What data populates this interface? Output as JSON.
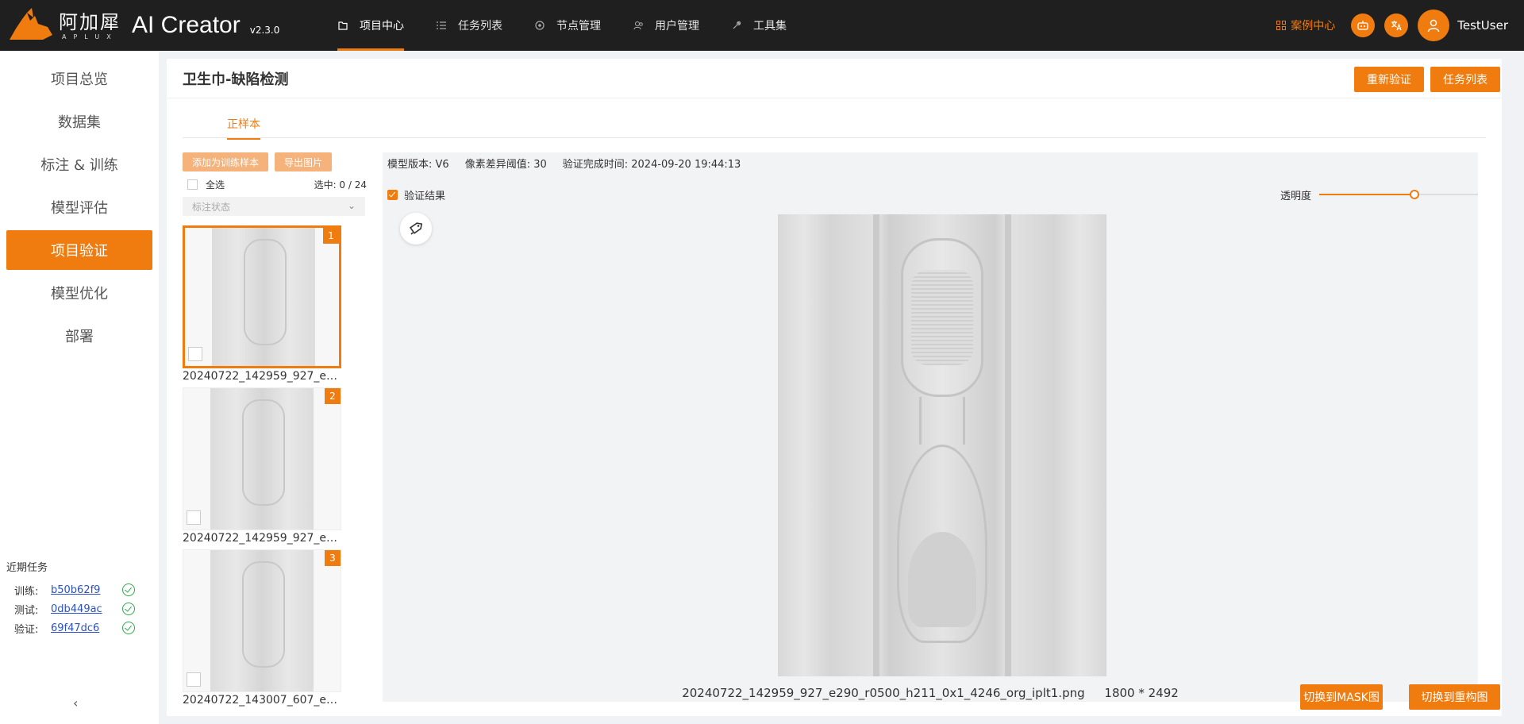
{
  "app": {
    "logo_cn": "阿加犀",
    "logo_en": "APLUX",
    "name": "AI Creator",
    "version": "v2.3.0"
  },
  "nav": [
    {
      "label": "项目中心",
      "icon": "folder-icon",
      "active": true
    },
    {
      "label": "任务列表",
      "icon": "list-icon",
      "active": false
    },
    {
      "label": "节点管理",
      "icon": "node-icon",
      "active": false
    },
    {
      "label": "用户管理",
      "icon": "users-icon",
      "active": false
    },
    {
      "label": "工具集",
      "icon": "wrench-icon",
      "active": false
    }
  ],
  "top_right": {
    "case_center": "案例中心",
    "username": "TestUser"
  },
  "sidebar": {
    "items": [
      {
        "label": "项目总览",
        "active": false
      },
      {
        "label": "数据集",
        "active": false
      },
      {
        "label": "标注 & 训练",
        "active": false
      },
      {
        "label": "模型评估",
        "active": false
      },
      {
        "label": "项目验证",
        "active": true
      },
      {
        "label": "模型优化",
        "active": false
      },
      {
        "label": "部署",
        "active": false
      }
    ],
    "recent": {
      "title": "近期任务",
      "rows": [
        {
          "label": "训练:",
          "id": "b50b62f9",
          "status": "success"
        },
        {
          "label": "测试:",
          "id": "0db449ac",
          "status": "success"
        },
        {
          "label": "验证:",
          "id": "69f47dc6",
          "status": "success"
        }
      ]
    },
    "collapse": "‹"
  },
  "main": {
    "title": "卫生巾-缺陷检测",
    "revalidate": "重新验证",
    "task_list": "任务列表",
    "tab": "正样本"
  },
  "thumbs": {
    "add_train": "添加为训练样本",
    "export": "导出图片",
    "select_all": "全选",
    "selected": "选中: 0 / 24",
    "filter_placeholder": "标注状态",
    "items": [
      {
        "index": "1",
        "name": "20240722_142959_927_e2...",
        "active": true
      },
      {
        "index": "2",
        "name": "20240722_142959_927_e2...",
        "active": false
      },
      {
        "index": "3",
        "name": "20240722_143007_607_e2...",
        "active": false
      }
    ]
  },
  "viewer": {
    "model_version": "模型版本: V6",
    "pixel_threshold": "像素差异阈值: 30",
    "finish_time": "验证完成时间: 2024-09-20 19:44:13",
    "show_result": "验证结果",
    "opacity_label": "透明度",
    "opacity_value": 0.6,
    "filename": "20240722_142959_927_e290_r0500_h211_0x1_4246_org_iplt1.png",
    "dimensions": "1800 * 2492",
    "switch_mask": "切换到MASK图",
    "switch_recon": "切换到重构图"
  },
  "colors": {
    "accent": "#f07c10",
    "topbar": "#1f1f1f",
    "link": "#2b52c7",
    "success": "#2fa84f"
  }
}
